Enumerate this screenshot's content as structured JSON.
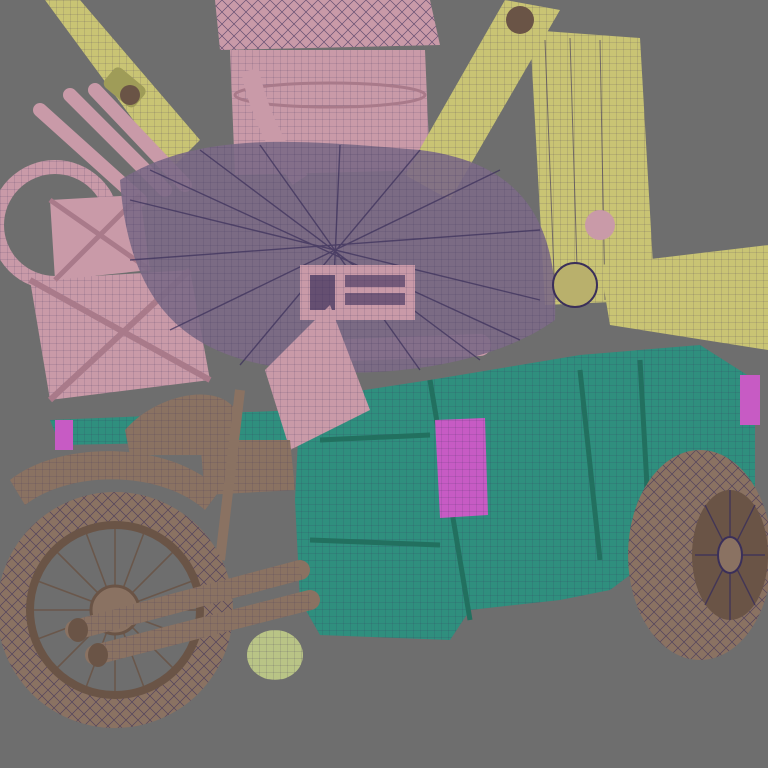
{
  "viewport": {
    "background": "#6e6e6e",
    "wire_color": "#3a2f5a"
  },
  "palette": {
    "pink": "#c99aa8",
    "pink_dark": "#a97a8a",
    "yellow": "#c9c474",
    "yellow_dark": "#9f9c58",
    "teal": "#2f8f7e",
    "teal_dark": "#22705f",
    "tan": "#8a7262",
    "tan_dark": "#6a5446",
    "magenta": "#c75bc4",
    "lime": "#b9c486",
    "wire": "#3a2f5a"
  },
  "objects": [
    {
      "name": "rear-wheel",
      "material": "tan"
    },
    {
      "name": "front-wheel",
      "material": "tan"
    },
    {
      "name": "cargo-bin",
      "material": "pink"
    },
    {
      "name": "hose-pipes",
      "material": "pink"
    },
    {
      "name": "shock-absorber-left",
      "material": "yellow"
    },
    {
      "name": "shock-absorber-right",
      "material": "yellow"
    },
    {
      "name": "boom-cylinder",
      "material": "yellow"
    },
    {
      "name": "tarp-cover",
      "material": "teal"
    },
    {
      "name": "cargo-net",
      "material": "wire"
    },
    {
      "name": "side-crate",
      "material": "pink"
    },
    {
      "name": "exhaust-pipes",
      "material": "tan"
    },
    {
      "name": "control-panel",
      "material": "pink"
    },
    {
      "name": "magenta-block",
      "material": "magenta"
    },
    {
      "name": "lime-weight",
      "material": "lime"
    },
    {
      "name": "yellow-crate",
      "material": "yellow"
    }
  ]
}
